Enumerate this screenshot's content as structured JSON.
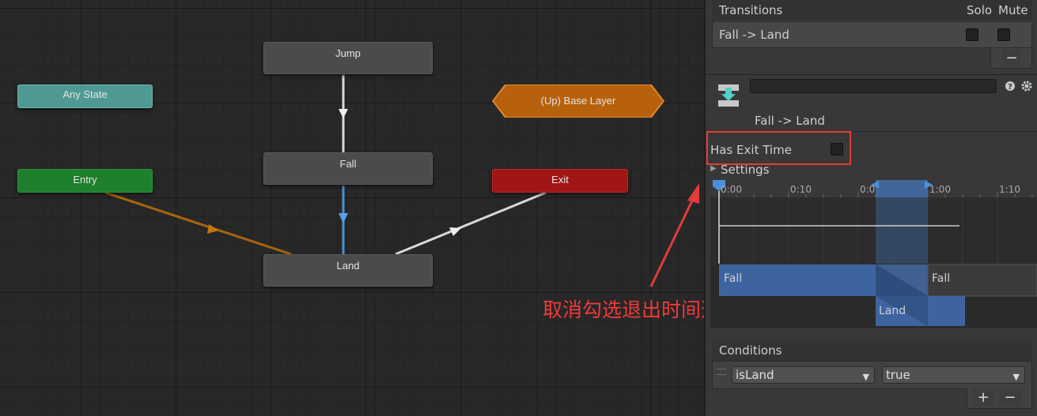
{
  "graph": {
    "nodes": {
      "jump": "Jump",
      "fall": "Fall",
      "land": "Land",
      "any_state": "Any State",
      "entry": "Entry",
      "exit": "Exit",
      "base_layer": "(Up) Base Layer"
    }
  },
  "annotation": "取消勾选退出时间选项",
  "inspector": {
    "transitions": {
      "title": "Transitions",
      "solo_label": "Solo",
      "mute_label": "Mute",
      "item": "Fall -> Land",
      "solo_checked": false,
      "mute_checked": false,
      "remove_label": "−"
    },
    "transition_name": "Fall -> Land",
    "has_exit_time_label": "Has Exit Time",
    "has_exit_time_checked": false,
    "settings_label": "Settings",
    "timeline": {
      "ticks": [
        "0:00",
        "0:10",
        "0:0",
        "1:00",
        "1:10"
      ],
      "source_clip": "Fall",
      "source_clip_after": "Fall",
      "dest_clip": "Land"
    },
    "conditions": {
      "title": "Conditions",
      "parameter": "isLand",
      "value": "true",
      "add_label": "+",
      "remove_label": "−"
    }
  },
  "colors": {
    "annotation_red": "#e33b3b",
    "transition_blue": "#4a90d9",
    "entry_green": "#1e7f2c",
    "exit_red": "#a11515",
    "base_layer_orange": "#b8610c",
    "any_state_teal": "#4e9a92"
  }
}
